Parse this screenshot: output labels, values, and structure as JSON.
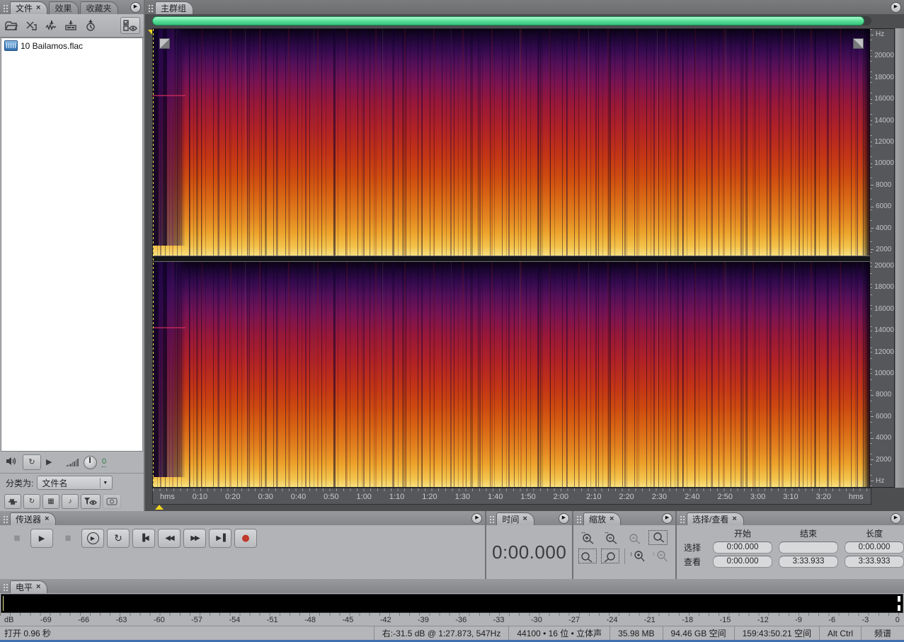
{
  "ui": {
    "close_glyph": "×",
    "menu_glyph": "▶",
    "dropdown_glyph": "▼"
  },
  "files_panel": {
    "tabs": [
      {
        "label": "文件"
      },
      {
        "label": "效果"
      },
      {
        "label": "收藏夹"
      }
    ],
    "file_list": [
      {
        "name": "10 Bailamos.flac"
      }
    ],
    "playback_row": {
      "volume_value": "0"
    },
    "sort_row": {
      "label": "分类为:",
      "value": "文件名"
    },
    "filter_icons": {
      "audio_note_glyph": "♪",
      "video_glyph": "▦",
      "loop_glyph": "↻"
    }
  },
  "main_panel": {
    "tab": "主群组",
    "freq_ticks_top": [
      "Hz",
      "20000",
      "18000",
      "16000",
      "14000",
      "12000",
      "10000",
      "8000",
      "6000",
      "4000",
      "2000"
    ],
    "freq_ticks_bottom": [
      "20000",
      "18000",
      "16000",
      "14000",
      "12000",
      "10000",
      "8000",
      "6000",
      "4000",
      "2000",
      "Hz"
    ],
    "time_ticks": [
      "hms",
      "0:10",
      "0:20",
      "0:30",
      "0:40",
      "0:50",
      "1:00",
      "1:10",
      "1:20",
      "1:30",
      "1:40",
      "1:50",
      "2:00",
      "2:10",
      "2:20",
      "2:30",
      "2:40",
      "2:50",
      "3:00",
      "3:10",
      "3:20",
      "hms"
    ]
  },
  "transport_panel": {
    "tab": "传送器",
    "buttons": [
      {
        "name": "stop-button",
        "glyph": "■"
      },
      {
        "name": "play-button",
        "glyph": "▶"
      },
      {
        "name": "pause-button",
        "glyph": "▮▮"
      },
      {
        "name": "play-from-cursor-button",
        "glyph": "▶"
      },
      {
        "name": "loop-play-button",
        "glyph": "↻"
      },
      {
        "name": "go-to-beginning-button",
        "glyph": "▐◀"
      },
      {
        "name": "rewind-button",
        "glyph": "◀◀"
      },
      {
        "name": "fast-forward-button",
        "glyph": "▶▶"
      },
      {
        "name": "go-to-end-button",
        "glyph": "▶▐"
      },
      {
        "name": "record-button",
        "glyph": "●"
      }
    ]
  },
  "time_panel": {
    "tab": "时间",
    "value": "0:00.000"
  },
  "zoom_panel": {
    "tab": "缩放"
  },
  "selection_panel": {
    "tab": "选择/查看",
    "columns": [
      "开始",
      "结束",
      "长度"
    ],
    "rows": [
      {
        "label": "选择",
        "start": "0:00.000",
        "end": "",
        "length": "0:00.000"
      },
      {
        "label": "查看",
        "start": "0:00.000",
        "end": "3:33.933",
        "length": "3:33.933"
      }
    ]
  },
  "levels_panel": {
    "tab": "电平",
    "db_ticks": [
      "dB",
      "-69",
      "-66",
      "-63",
      "-60",
      "-57",
      "-54",
      "-51",
      "-48",
      "-45",
      "-42",
      "-39",
      "-36",
      "-33",
      "-30",
      "-27",
      "-24",
      "-21",
      "-18",
      "-15",
      "-12",
      "-9",
      "-6",
      "-3",
      "0"
    ]
  },
  "status_bar": {
    "items": [
      "打开 0.96 秒",
      "右:-31.5 dB @  1:27.873, 547Hz",
      "44100 • 16 位 • 立体声",
      "35.98 MB",
      "94.46 GB 空间",
      "159:43:50.21 空间",
      "Alt Ctrl",
      "频谱"
    ]
  }
}
